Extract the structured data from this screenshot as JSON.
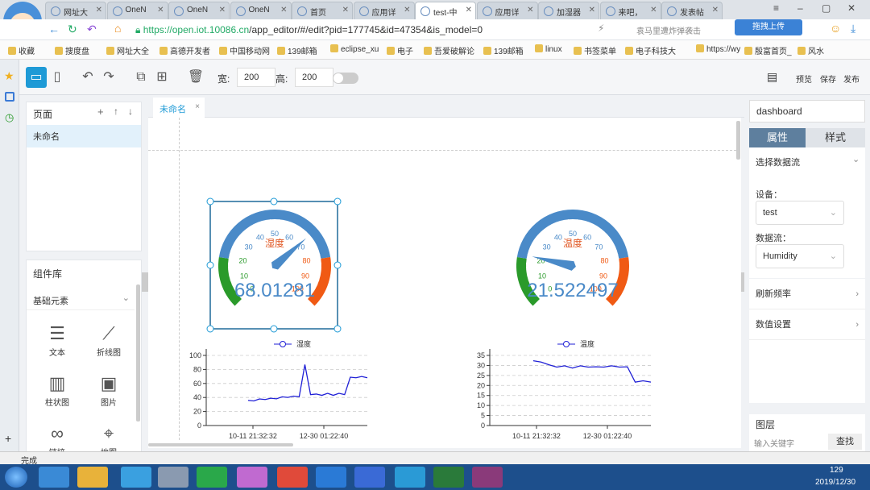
{
  "browser": {
    "tabs": [
      {
        "label": "网址大"
      },
      {
        "label": "OneN"
      },
      {
        "label": "OneN"
      },
      {
        "label": "OneN"
      },
      {
        "label": "首页"
      },
      {
        "label": "应用详"
      },
      {
        "label": "test-中"
      },
      {
        "label": "应用详"
      },
      {
        "label": "加湿器"
      },
      {
        "label": "来吧，"
      },
      {
        "label": "发表帖"
      }
    ],
    "url_host": "https://open.iot.10086.cn",
    "url_path": "/app_editor/#/edit?pid=177745&id=47354&is_model=0",
    "search_hint": "袁马里遭炸弹袭击",
    "upload_button": "拖拽上传",
    "bookmarks": [
      "收藏",
      "搜度盘",
      "网址大全",
      "高德开发者",
      "中国移动网",
      "139邮箱",
      "eclipse_xu",
      "电子",
      "吾爱破解论",
      "139邮箱",
      "linux",
      "书签菜单",
      "电子科技大",
      "https://wy",
      "殷富首页_",
      "风水"
    ]
  },
  "toolbar": {
    "width_label": "宽:",
    "width_value": "200",
    "height_label": "高:",
    "height_value": "200",
    "preview": "预览",
    "save": "保存",
    "publish": "发布"
  },
  "pages_panel": {
    "title": "页面",
    "items": [
      "未命名"
    ]
  },
  "components_panel": {
    "title": "组件库",
    "category": "基础元素",
    "items": [
      {
        "label": "文本",
        "icon": "text-icon"
      },
      {
        "label": "折线图",
        "icon": "line-chart-icon"
      },
      {
        "label": "柱状图",
        "icon": "bar-chart-icon"
      },
      {
        "label": "图片",
        "icon": "image-icon"
      },
      {
        "label": "链接",
        "icon": "link-icon"
      },
      {
        "label": "地图",
        "icon": "map-icon"
      }
    ]
  },
  "editor": {
    "tab_name": "未命名"
  },
  "gauges": [
    {
      "title": "湿度",
      "value": "68.01281",
      "needle": 68.01,
      "ticks": [
        "0",
        "10",
        "20",
        "30",
        "40",
        "50",
        "60",
        "70",
        "80",
        "90",
        "100"
      ]
    },
    {
      "title": "温度",
      "value": "21.522497",
      "needle": 21.52,
      "ticks": [
        "0",
        "10",
        "20",
        "30",
        "40",
        "50",
        "60",
        "70",
        "80",
        "90",
        "100"
      ]
    }
  ],
  "chart_data": [
    {
      "type": "line",
      "title": "",
      "series": [
        {
          "name": "湿度",
          "values": [
            35,
            36,
            37,
            38,
            38,
            39,
            40,
            41,
            41,
            42,
            86,
            45,
            44,
            44,
            45,
            44,
            45,
            45,
            68,
            69,
            69,
            69
          ]
        }
      ],
      "x_tick_labels": [
        "10-11 21:32:32",
        "12-30 01:22:40"
      ],
      "yticks": [
        "0",
        "20",
        "40",
        "60",
        "80",
        "100"
      ],
      "ylim": [
        0,
        100
      ],
      "legend": "top-center",
      "grid": true
    },
    {
      "type": "line",
      "title": "",
      "series": [
        {
          "name": "温度",
          "values": [
            32,
            32,
            30,
            29.5,
            29.5,
            29,
            29.5,
            29.5,
            29,
            29.5,
            29.5,
            29.5,
            29,
            22,
            22,
            22
          ]
        }
      ],
      "x_tick_labels": [
        "10-11 21:32:32",
        "12-30 01:22:40"
      ],
      "yticks": [
        "0",
        "5",
        "10",
        "15",
        "20",
        "25",
        "30",
        "35"
      ],
      "ylim": [
        0,
        35
      ],
      "legend": "top-center",
      "grid": true
    }
  ],
  "right_panel": {
    "name_input": "dashboard",
    "tab_props": "属性",
    "tab_style": "样式",
    "datastream_section": "选择数据流",
    "device_label": "设备：",
    "device_value": "test",
    "stream_label": "数据流：",
    "stream_value": "Humidity",
    "refresh": "刷新频率",
    "value_settings": "数值设置",
    "layers_title": "图层",
    "layers_placeholder": "输入关键字",
    "find_button": "查找"
  },
  "status": {
    "text": "完成",
    "clock_time": "129",
    "clock_date": "2019/12/30"
  },
  "colors": {
    "accent": "#1e9ad6",
    "gauge_blue": "#4a8ac8",
    "gauge_green": "#2a9a2a",
    "gauge_red": "#f05a14",
    "line_blue": "#1f1fd6"
  }
}
